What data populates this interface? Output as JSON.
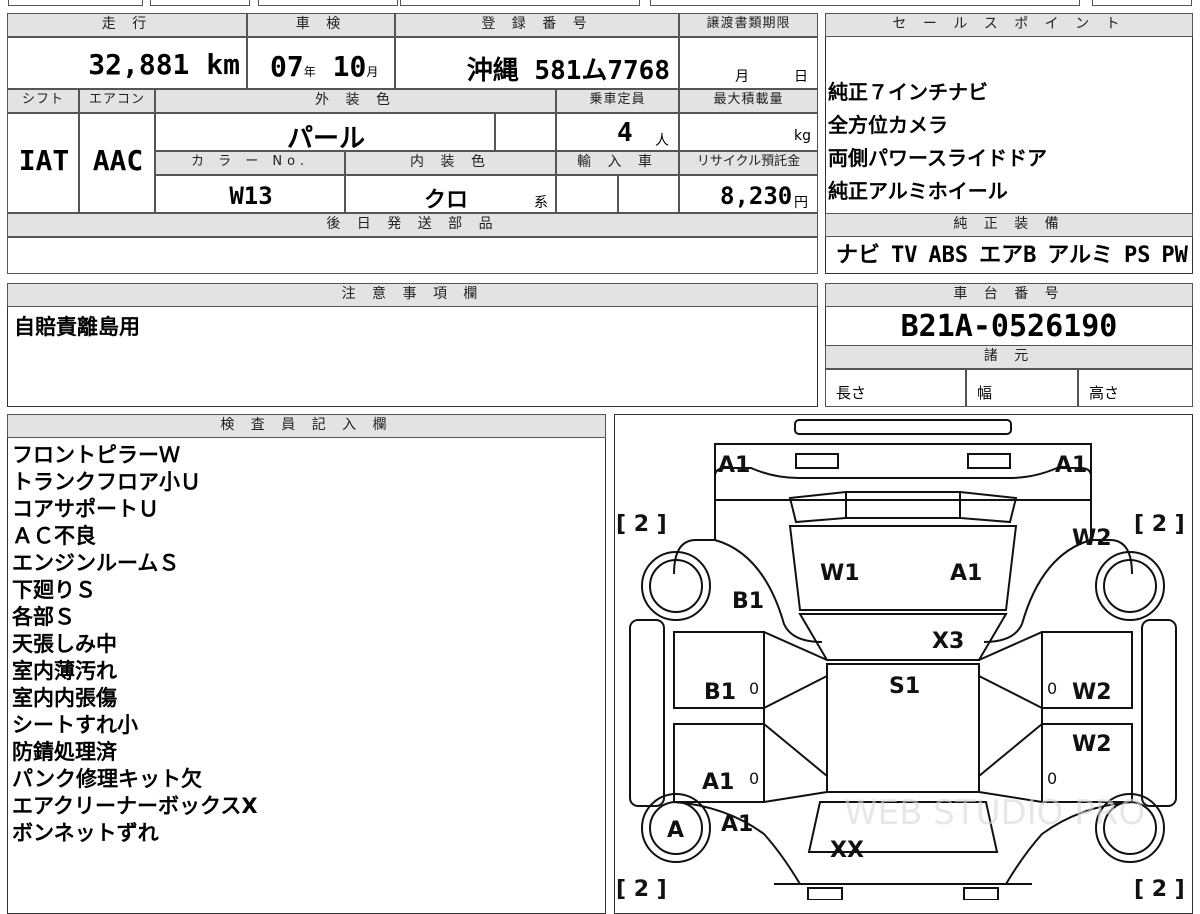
{
  "hdr": {
    "mileage": "走 行",
    "inspection": "車 検",
    "reg_no": "登 録 番 号",
    "doc_deadline": "譲渡書類期限",
    "sales_points": "セ ー ル ス ポ イ ン ト",
    "shift": "シフト",
    "aircon": "エアコン",
    "exterior": "外 装 色",
    "capacity": "乗車定員",
    "max_load": "最大積載量",
    "color_no": "カ ラ ー No.",
    "interior": "内 装 色",
    "import": "輸 入 車",
    "recycle": "リサイクル預託金",
    "later_parts": "後 日 発 送 部 品",
    "equipment": "純 正 装 備",
    "notes": "注 意 事 項 欄",
    "chassis": "車 台 番 号",
    "specs": "諸 元",
    "inspector": "検 査 員 記 入 欄"
  },
  "vals": {
    "mileage": "32,881",
    "mileage_unit": "km",
    "insp_year": "07",
    "insp_year_unit": "年",
    "insp_month": "10",
    "insp_month_unit": "月",
    "reg_no": "沖縄 581ム7768",
    "deadline_month": "月",
    "deadline_day": "日",
    "shift": "IAT",
    "aircon": "AAC",
    "exterior": "パール",
    "capacity": "4",
    "capacity_unit": "人",
    "load_unit": "kg",
    "color_no": "W13",
    "interior": "クロ",
    "interior_unit": "系",
    "recycle": "8,230",
    "recycle_unit": "円",
    "chassis": "B21A-0526190",
    "len": "長さ",
    "width": "幅",
    "height": "高さ"
  },
  "sales_points": [
    "純正７インチナビ",
    "全方位カメラ",
    "両側パワースライドドア",
    "純正アルミホイール"
  ],
  "equipment": [
    "ナビ",
    "TV",
    "ABS",
    "エアB",
    "アルミ",
    "PS",
    "PW"
  ],
  "notes": [
    "自賠責離島用"
  ],
  "inspector_notes": [
    "フロントピラーＷ",
    "トランクフロア小Ｕ",
    "コアサポートＵ",
    "ＡＣ不良",
    "エンジンルームＳ",
    "下廻りＳ",
    "各部Ｓ",
    "天張しみ中",
    "室内薄汚れ",
    "室内内張傷",
    "シートすれ小",
    "防錆処理済",
    "パンク修理キット欠",
    "エアクリーナーボックスX",
    "ボンネットずれ"
  ],
  "diagram": {
    "A1_fl": "A1",
    "A1_fr": "A1",
    "br_tl": "[ 2 ]",
    "br_tr": "[ 2 ]",
    "br_bl": "[ 2 ]",
    "br_br": "[ 2 ]",
    "W2_top": "W2",
    "W1": "W1",
    "A1_roof": "A1",
    "B1_top": "B1",
    "X3": "X3",
    "B1_left": "B1",
    "S1": "S1",
    "W2_r1": "W2",
    "W2_r2": "W2",
    "A1_left": "A1",
    "A1_rear": "A1",
    "A_tire": "A",
    "XX": "XX",
    "zero": "0",
    "watermark": "WEB STUDIO PRO"
  }
}
